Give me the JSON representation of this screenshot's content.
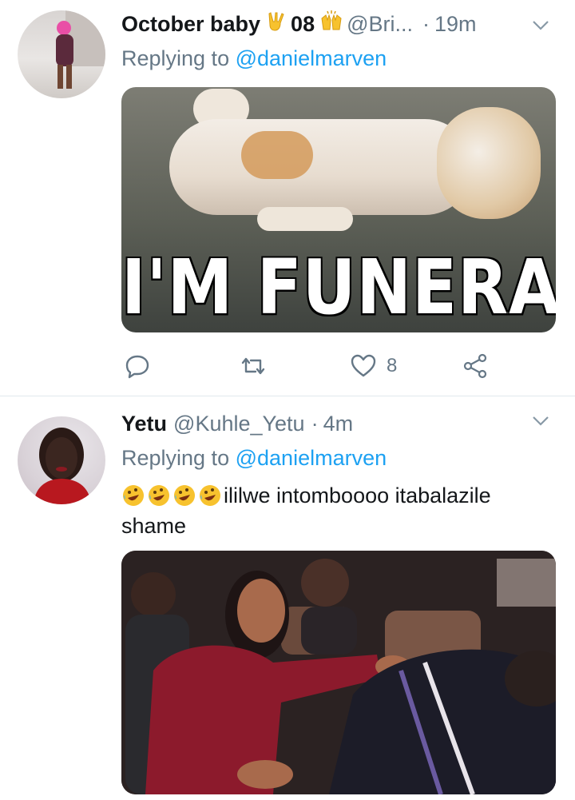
{
  "tweets": [
    {
      "display_name": "October baby",
      "name_suffix": "08",
      "handle": "@Bri...",
      "separator": "·",
      "time": "19m",
      "replying_prefix": "Replying to",
      "replying_to": "@danielmarven",
      "media_caption": "I'M FUNERAL",
      "actions": {
        "reply_icon": "reply-icon",
        "retweet_icon": "retweet-icon",
        "like_icon": "heart-icon",
        "like_count": "8",
        "share_icon": "share-icon"
      },
      "emoji": [
        "victory-hand-emoji",
        "raising-hands-emoji"
      ]
    },
    {
      "display_name": "Yetu",
      "handle": "@Kuhle_Yetu",
      "separator": "·",
      "time": "4m",
      "replying_prefix": "Replying to",
      "replying_to": "@danielmarven",
      "text": "ililwe intomboooo itabalazile shame",
      "emoji": [
        "rolling-on-floor-laughing-emoji",
        "rolling-on-floor-laughing-emoji",
        "rolling-on-floor-laughing-emoji",
        "rolling-on-floor-laughing-emoji"
      ]
    }
  ],
  "colors": {
    "link": "#1da1f2",
    "secondary": "#657786",
    "text": "#14171a",
    "divider": "#e1e8ed",
    "emoji_yellow": "#f7c22e"
  }
}
